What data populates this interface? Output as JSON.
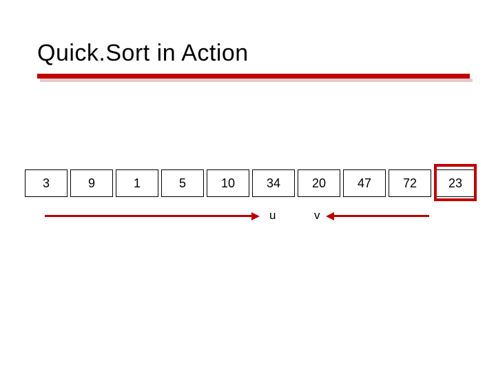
{
  "title": "Quick.Sort in Action",
  "array": [
    "3",
    "9",
    "1",
    "5",
    "10",
    "34",
    "20",
    "47",
    "72",
    "23"
  ],
  "pointers": {
    "u": "u",
    "v": "v"
  },
  "colors": {
    "accent": "#c00000"
  }
}
